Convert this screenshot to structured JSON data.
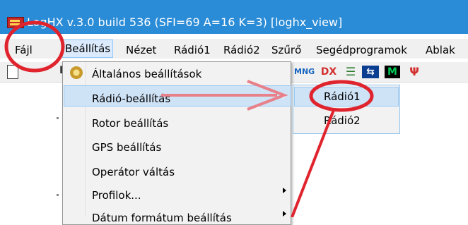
{
  "window": {
    "title": "LogHX v.3.0 build 536 (SFI=69 A=16 K=3) [loghx_view]"
  },
  "menubar": {
    "items": [
      {
        "key": "fajl",
        "label": "Fájl"
      },
      {
        "key": "beallitas",
        "label": "Beállítás"
      },
      {
        "key": "nezet",
        "label": "Nézet"
      },
      {
        "key": "radio1",
        "label": "Rádió1"
      },
      {
        "key": "radio2",
        "label": "Rádió2"
      },
      {
        "key": "szuro",
        "label": "Szűrő"
      },
      {
        "key": "segedprogramok",
        "label": "Segédprogramok"
      },
      {
        "key": "ablak",
        "label": "Ablak"
      }
    ]
  },
  "toolbar": {
    "b_label": "B",
    "icons": [
      {
        "name": "mng-icon",
        "text": "MNG",
        "color": "#1565c0"
      },
      {
        "name": "dx-icon",
        "text": "DX",
        "color": "#d32f2f"
      },
      {
        "name": "list-icon",
        "text": "☰",
        "color": "#2e7d32"
      },
      {
        "name": "network-icon",
        "text": "⇆",
        "color": "#0b3d91"
      },
      {
        "name": "waveform-icon",
        "text": "M",
        "color": "#00c853"
      },
      {
        "name": "antenna-icon",
        "text": "Ψ",
        "color": "#d32f2f"
      }
    ]
  },
  "dropdown": {
    "items": [
      {
        "label": "Általános beállítások",
        "has_submenu": false
      },
      {
        "label": "Rádió-beállítás",
        "has_submenu": true
      },
      {
        "label": "Rotor beállítás",
        "has_submenu": false
      },
      {
        "label": "GPS beállítás",
        "has_submenu": false
      },
      {
        "label": "Operátor váltás",
        "has_submenu": false
      },
      {
        "label": "Profilok...",
        "has_submenu": true
      },
      {
        "label": "Dátum formátum beállítás",
        "has_submenu": true
      }
    ]
  },
  "submenu": {
    "items": [
      {
        "label": "Rádió1"
      },
      {
        "label": "Rádió2"
      }
    ]
  },
  "annotation_colors": {
    "circle": "#e0242e",
    "arrow": "#e8808a"
  }
}
